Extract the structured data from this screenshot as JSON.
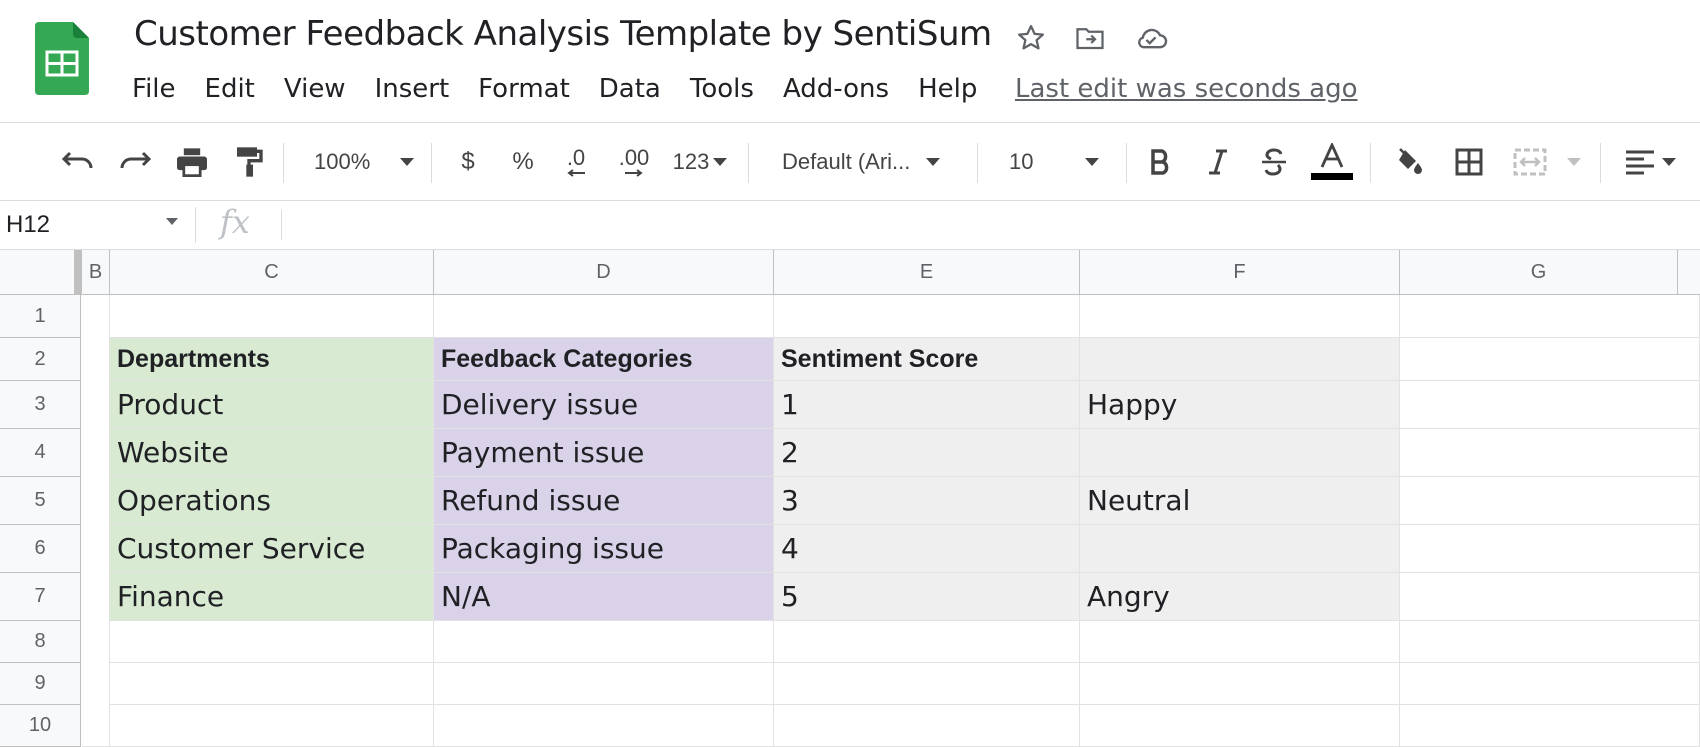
{
  "header": {
    "title": "Customer Feedback Analysis Template by SentiSum",
    "menu": [
      "File",
      "Edit",
      "View",
      "Insert",
      "Format",
      "Data",
      "Tools",
      "Add-ons",
      "Help"
    ],
    "last_edit": "Last edit was seconds ago",
    "icons": [
      "star-icon",
      "move-to-folder-icon",
      "cloud-saved-icon"
    ]
  },
  "toolbar": {
    "zoom": "100%",
    "currency": "$",
    "percent": "%",
    "decrease_decimal": ".0",
    "increase_decimal": ".00",
    "more_formats": "123",
    "font": "Default (Ari...",
    "font_size": "10",
    "colors": {
      "text_color_bar": "#000000"
    }
  },
  "formula_bar": {
    "name_box": "H12",
    "fx": "fx",
    "content": ""
  },
  "grid": {
    "columns": [
      "B",
      "C",
      "D",
      "E",
      "F",
      "G"
    ],
    "rows": [
      "1",
      "2",
      "3",
      "4",
      "5",
      "6",
      "7",
      "8",
      "9",
      "10"
    ],
    "cells": {
      "C2": "Departments",
      "D2": "Feedback Categories",
      "E2": "Sentiment Score",
      "C3": "Product",
      "D3": "Delivery issue",
      "E3": "1",
      "F3": "Happy",
      "C4": "Website",
      "D4": "Payment issue",
      "E4": "2",
      "C5": "Operations",
      "D5": "Refund issue",
      "E5": "3",
      "F5": "Neutral",
      "C6": "Customer Service",
      "D6": "Packaging issue",
      "E6": "4",
      "C7": "Finance",
      "D7": "N/A",
      "E7": "5",
      "F7": "Angry"
    },
    "colors": {
      "departments": "#d9ead3",
      "categories": "#d9d2e9",
      "scores": "#efefef"
    }
  }
}
